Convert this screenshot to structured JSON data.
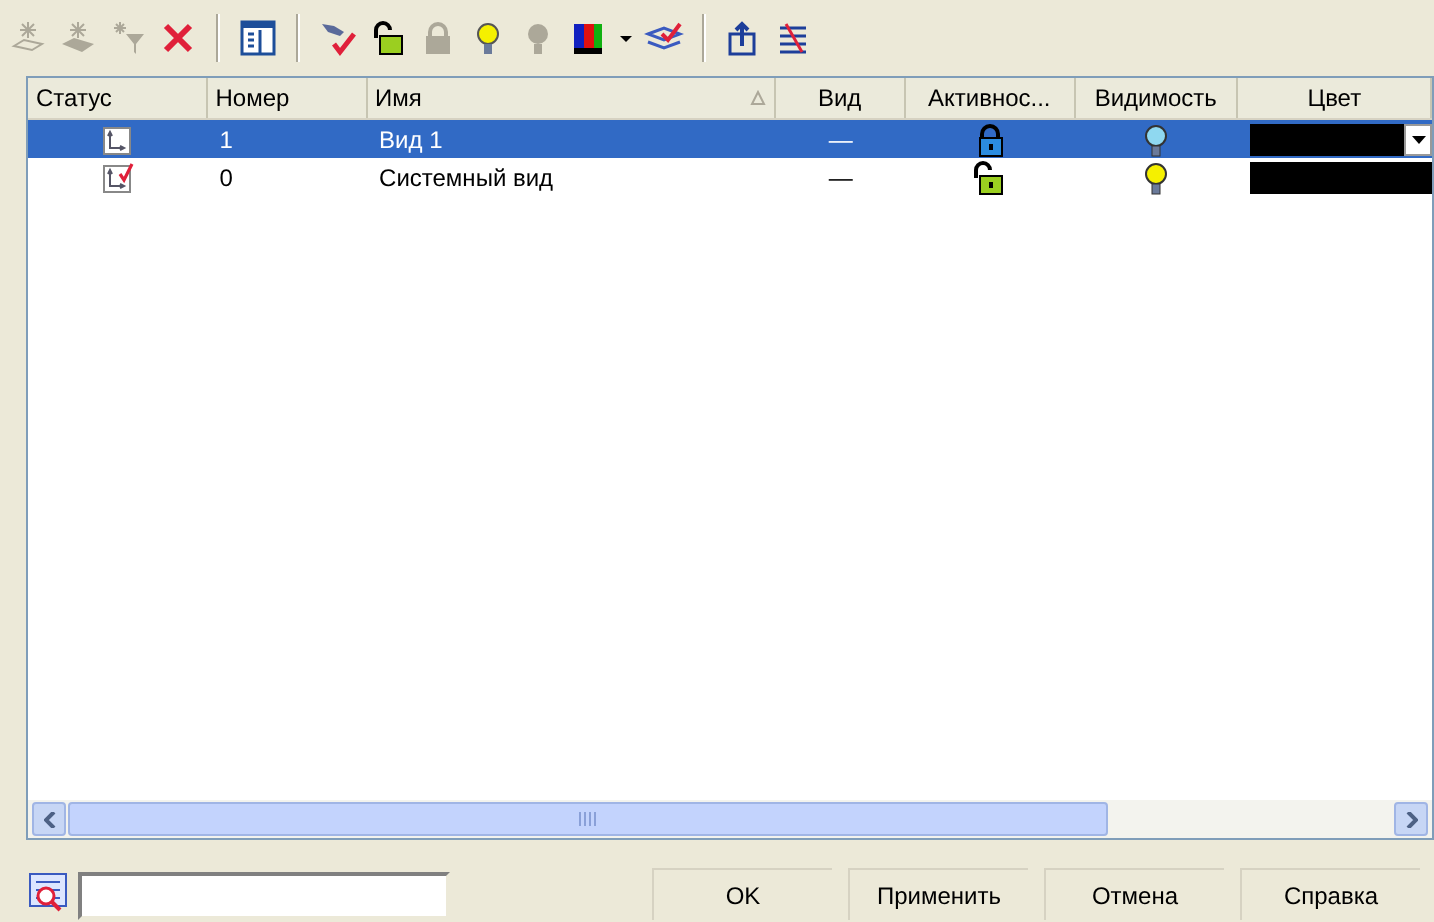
{
  "toolbar": [
    {
      "kind": "new-view",
      "disabled": true
    },
    {
      "kind": "new-views",
      "disabled": true
    },
    {
      "kind": "filter",
      "disabled": true
    },
    {
      "kind": "delete",
      "disabled": false
    },
    {
      "kind": "separator"
    },
    {
      "kind": "properties",
      "disabled": false
    },
    {
      "kind": "separator"
    },
    {
      "kind": "set-current",
      "disabled": false
    },
    {
      "kind": "unlock",
      "disabled": false
    },
    {
      "kind": "lock",
      "disabled": true
    },
    {
      "kind": "show",
      "disabled": false
    },
    {
      "kind": "hide",
      "disabled": true
    },
    {
      "kind": "color",
      "disabled": false
    },
    {
      "kind": "dropdown"
    },
    {
      "kind": "layers",
      "disabled": false
    },
    {
      "kind": "separator"
    },
    {
      "kind": "export",
      "disabled": false
    },
    {
      "kind": "import",
      "disabled": false
    }
  ],
  "table": {
    "columns": [
      {
        "label": "Статус",
        "sorted": false
      },
      {
        "label": "Номер",
        "sorted": false
      },
      {
        "label": "Имя",
        "sorted": true
      },
      {
        "label": "Вид",
        "sorted": false
      },
      {
        "label": "Активнос...",
        "sorted": false
      },
      {
        "label": "Видимость",
        "sorted": false
      },
      {
        "label": "Цвет",
        "sorted": false
      }
    ],
    "rows": [
      {
        "selected": true,
        "current": false,
        "number": "1",
        "name": "Вид 1",
        "view": "—",
        "locked": true,
        "visible": true,
        "color": "#000000"
      },
      {
        "selected": false,
        "current": true,
        "number": "0",
        "name": "Системный вид",
        "view": "—",
        "locked": false,
        "visible": true,
        "color": "#000000"
      }
    ]
  },
  "buttons": [
    {
      "label": "OK"
    },
    {
      "label": "Применить"
    },
    {
      "label": "Отмена"
    },
    {
      "label": "Справка"
    }
  ]
}
